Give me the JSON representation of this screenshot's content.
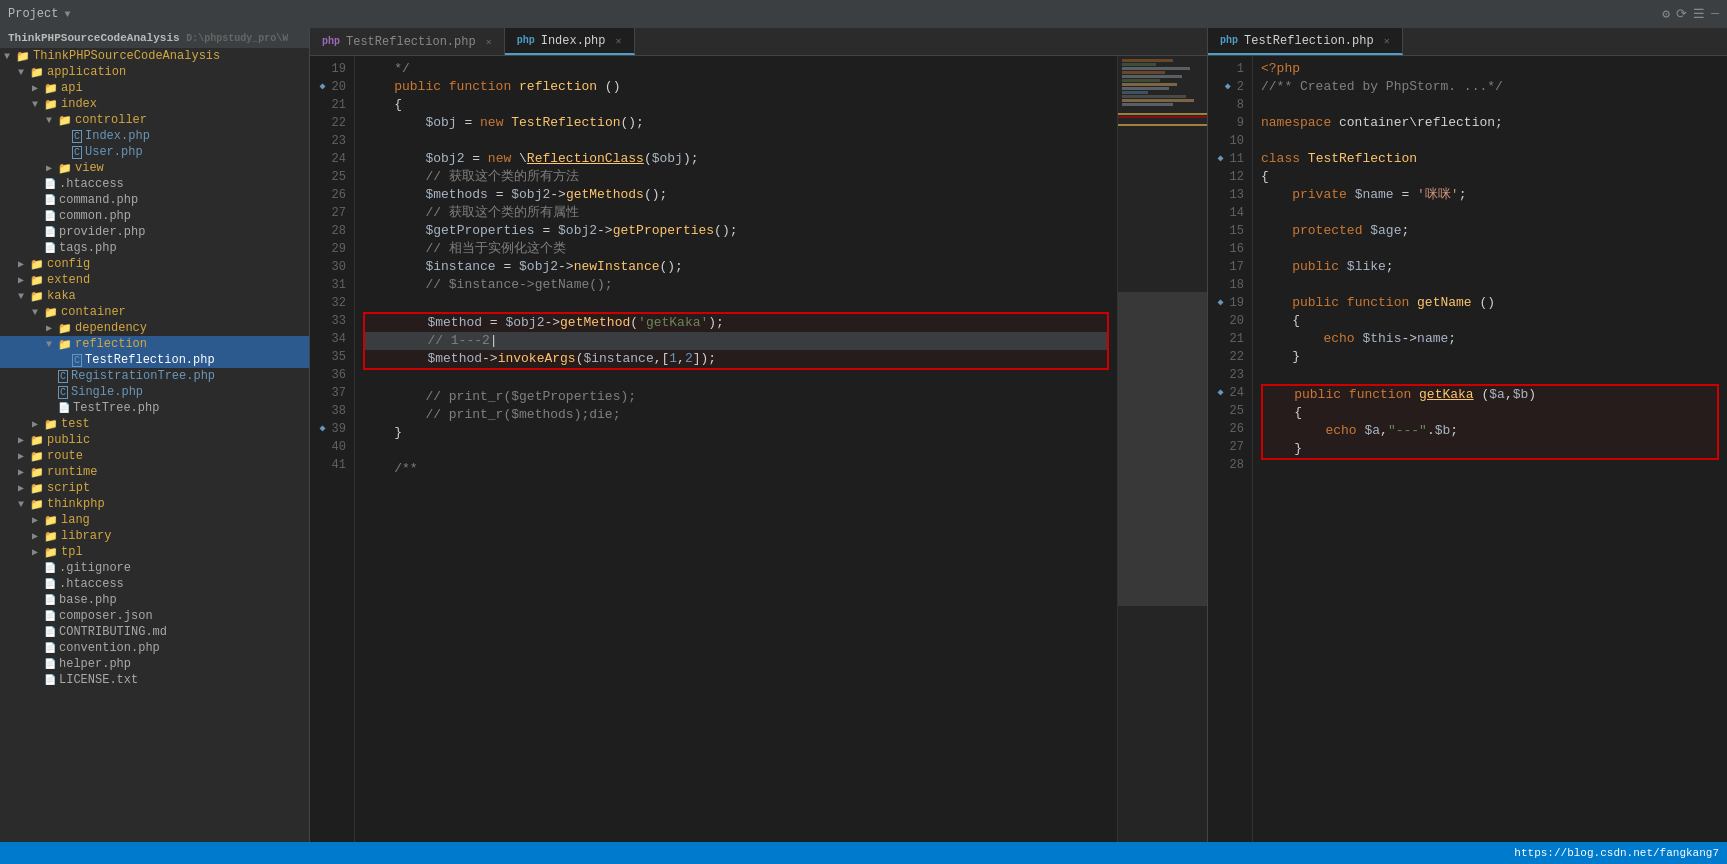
{
  "topbar": {
    "project_label": "Project",
    "icons": [
      "⚙",
      "⊟",
      "☰",
      "—"
    ]
  },
  "tabs_left": [
    {
      "label": "TestReflection.php",
      "active": false,
      "icon": "php"
    },
    {
      "label": "Index.php",
      "active": true,
      "icon": "php"
    }
  ],
  "tabs_right": [
    {
      "label": "TestReflection.php",
      "active": true,
      "icon": "php"
    }
  ],
  "sidebar": {
    "title": "ThinkPHPSourceCodeAnalysis",
    "path": "D:\\phpstudy_pro\\W",
    "tree": [
      {
        "indent": 0,
        "type": "folder",
        "open": true,
        "label": "ThinkPHPSourceCodeAnalysis",
        "prefix": "▼"
      },
      {
        "indent": 1,
        "type": "folder",
        "open": true,
        "label": "application",
        "prefix": "▼"
      },
      {
        "indent": 2,
        "type": "folder",
        "open": false,
        "label": "api",
        "prefix": "▶"
      },
      {
        "indent": 2,
        "type": "folder",
        "open": true,
        "label": "index",
        "prefix": "▼"
      },
      {
        "indent": 3,
        "type": "folder",
        "open": true,
        "label": "controller",
        "prefix": "▼"
      },
      {
        "indent": 4,
        "type": "php_file",
        "label": "Index.php",
        "prefix": " "
      },
      {
        "indent": 4,
        "type": "php_file",
        "label": "User.php",
        "prefix": " "
      },
      {
        "indent": 3,
        "type": "folder",
        "open": false,
        "label": "view",
        "prefix": "▶"
      },
      {
        "indent": 2,
        "type": "other_file",
        "label": ".htaccess",
        "prefix": " "
      },
      {
        "indent": 2,
        "type": "other_file",
        "label": "command.php",
        "prefix": " "
      },
      {
        "indent": 2,
        "type": "other_file",
        "label": "common.php",
        "prefix": " "
      },
      {
        "indent": 2,
        "type": "other_file",
        "label": "provider.php",
        "prefix": " "
      },
      {
        "indent": 2,
        "type": "other_file",
        "label": "tags.php",
        "prefix": " "
      },
      {
        "indent": 1,
        "type": "folder",
        "open": false,
        "label": "config",
        "prefix": "▶"
      },
      {
        "indent": 1,
        "type": "folder",
        "open": false,
        "label": "extend",
        "prefix": "▶"
      },
      {
        "indent": 1,
        "type": "folder",
        "open": true,
        "label": "kaka",
        "prefix": "▼"
      },
      {
        "indent": 2,
        "type": "folder",
        "open": true,
        "label": "container",
        "prefix": "▼"
      },
      {
        "indent": 3,
        "type": "folder",
        "open": false,
        "label": "dependency",
        "prefix": "▶"
      },
      {
        "indent": 3,
        "type": "folder",
        "open": true,
        "label": "reflection",
        "prefix": "▼",
        "selected": true
      },
      {
        "indent": 4,
        "type": "php_file_selected",
        "label": "TestReflection.php",
        "prefix": " ",
        "selected": true
      },
      {
        "indent": 3,
        "type": "php_file",
        "label": "RegistrationTree.php",
        "prefix": " "
      },
      {
        "indent": 3,
        "type": "php_file",
        "label": "Single.php",
        "prefix": " "
      },
      {
        "indent": 3,
        "type": "other_file",
        "label": "TestTree.php",
        "prefix": " "
      },
      {
        "indent": 2,
        "type": "folder",
        "open": false,
        "label": "test",
        "prefix": "▶"
      },
      {
        "indent": 1,
        "type": "folder",
        "open": false,
        "label": "public",
        "prefix": "▶"
      },
      {
        "indent": 1,
        "type": "folder",
        "open": false,
        "label": "route",
        "prefix": "▶"
      },
      {
        "indent": 1,
        "type": "folder",
        "open": false,
        "label": "runtime",
        "prefix": "▶"
      },
      {
        "indent": 1,
        "type": "folder",
        "open": false,
        "label": "script",
        "prefix": "▶"
      },
      {
        "indent": 1,
        "type": "folder",
        "open": true,
        "label": "thinkphp",
        "prefix": "▼"
      },
      {
        "indent": 2,
        "type": "folder",
        "open": false,
        "label": "lang",
        "prefix": "▶"
      },
      {
        "indent": 2,
        "type": "folder",
        "open": false,
        "label": "library",
        "prefix": "▶"
      },
      {
        "indent": 2,
        "type": "folder",
        "open": false,
        "label": "tpl",
        "prefix": "▶"
      },
      {
        "indent": 2,
        "type": "other_file",
        "label": ".gitignore",
        "prefix": " "
      },
      {
        "indent": 2,
        "type": "other_file",
        "label": ".htaccess",
        "prefix": " "
      },
      {
        "indent": 2,
        "type": "other_file",
        "label": "base.php",
        "prefix": " "
      },
      {
        "indent": 2,
        "type": "other_file",
        "label": "composer.json",
        "prefix": " "
      },
      {
        "indent": 2,
        "type": "other_file",
        "label": "CONTRIBUTING.md",
        "prefix": " "
      },
      {
        "indent": 2,
        "type": "other_file",
        "label": "convention.php",
        "prefix": " "
      },
      {
        "indent": 2,
        "type": "other_file",
        "label": "helper.php",
        "prefix": " "
      },
      {
        "indent": 2,
        "type": "other_file",
        "label": "LICENSE.txt",
        "prefix": " "
      }
    ]
  },
  "left_editor": {
    "lines": [
      {
        "num": 19,
        "content": "    */",
        "gutter": ""
      },
      {
        "num": 20,
        "content": "    public function reflection ()",
        "gutter": "arrow"
      },
      {
        "num": 21,
        "content": "    {",
        "gutter": ""
      },
      {
        "num": 22,
        "content": "        $obj = new TestReflection();",
        "gutter": ""
      },
      {
        "num": 23,
        "content": "",
        "gutter": ""
      },
      {
        "num": 24,
        "content": "        $obj2 = new \\ReflectionClass($obj);",
        "gutter": ""
      },
      {
        "num": 25,
        "content": "        // 获取这个类的所有方法",
        "gutter": ""
      },
      {
        "num": 26,
        "content": "        $methods = $obj2->getMethods();",
        "gutter": ""
      },
      {
        "num": 27,
        "content": "        // 获取这个类的所有属性",
        "gutter": ""
      },
      {
        "num": 28,
        "content": "        $getProperties = $obj2->getProperties();",
        "gutter": ""
      },
      {
        "num": 29,
        "content": "        // 相当于实例化这个类",
        "gutter": ""
      },
      {
        "num": 30,
        "content": "        $instance = $obj2->newInstance();",
        "gutter": ""
      },
      {
        "num": 31,
        "content": "        // $instance->getName();",
        "gutter": ""
      },
      {
        "num": 32,
        "content": "",
        "gutter": ""
      },
      {
        "num": 33,
        "content": "        $method = $obj2->getMethod('getKaka');",
        "gutter": "",
        "boxed": true
      },
      {
        "num": 34,
        "content": "        // 1---2",
        "gutter": "",
        "boxed": true,
        "current": true
      },
      {
        "num": 35,
        "content": "        $method->invokeArgs($instance,[1,2]);",
        "gutter": "",
        "boxed": true
      },
      {
        "num": 36,
        "content": "",
        "gutter": ""
      },
      {
        "num": 37,
        "content": "        // print_r($getProperties);",
        "gutter": ""
      },
      {
        "num": 38,
        "content": "        // print_r($methods);die;",
        "gutter": ""
      },
      {
        "num": 39,
        "content": "    }",
        "gutter": "arrow"
      },
      {
        "num": 40,
        "content": "",
        "gutter": ""
      },
      {
        "num": 41,
        "content": "    /**",
        "gutter": ""
      }
    ]
  },
  "right_editor": {
    "lines": [
      {
        "num": 1,
        "content": "<?php",
        "gutter": ""
      },
      {
        "num": 2,
        "content": "//** Created by PhpStorm. ...*/",
        "gutter": "arrow"
      },
      {
        "num": 8,
        "content": "",
        "gutter": ""
      },
      {
        "num": 9,
        "content": "namespace container\\reflection;",
        "gutter": ""
      },
      {
        "num": 10,
        "content": "",
        "gutter": ""
      },
      {
        "num": 11,
        "content": "class TestReflection",
        "gutter": "arrow"
      },
      {
        "num": 12,
        "content": "{",
        "gutter": ""
      },
      {
        "num": 13,
        "content": "    private $name = '咪咪';",
        "gutter": ""
      },
      {
        "num": 14,
        "content": "",
        "gutter": ""
      },
      {
        "num": 15,
        "content": "    protected $age;",
        "gutter": ""
      },
      {
        "num": 16,
        "content": "",
        "gutter": ""
      },
      {
        "num": 17,
        "content": "    public $like;",
        "gutter": ""
      },
      {
        "num": 18,
        "content": "",
        "gutter": ""
      },
      {
        "num": 19,
        "content": "    public function getName ()",
        "gutter": "arrow"
      },
      {
        "num": 20,
        "content": "    {",
        "gutter": ""
      },
      {
        "num": 21,
        "content": "        echo $this->name;",
        "gutter": ""
      },
      {
        "num": 22,
        "content": "    }",
        "gutter": ""
      },
      {
        "num": 23,
        "content": "",
        "gutter": ""
      },
      {
        "num": 24,
        "content": "    public function getKaka ($a,$b)",
        "gutter": "arrow",
        "boxed": true
      },
      {
        "num": 25,
        "content": "    {",
        "gutter": "",
        "boxed": true
      },
      {
        "num": 26,
        "content": "        echo $a,\"---\".$b;",
        "gutter": "",
        "boxed": true
      },
      {
        "num": 27,
        "content": "    }",
        "gutter": "",
        "boxed": true
      },
      {
        "num": 28,
        "content": "",
        "gutter": ""
      }
    ]
  },
  "status_bar": {
    "url": "https://blog.csdn.net/fangkang7"
  }
}
